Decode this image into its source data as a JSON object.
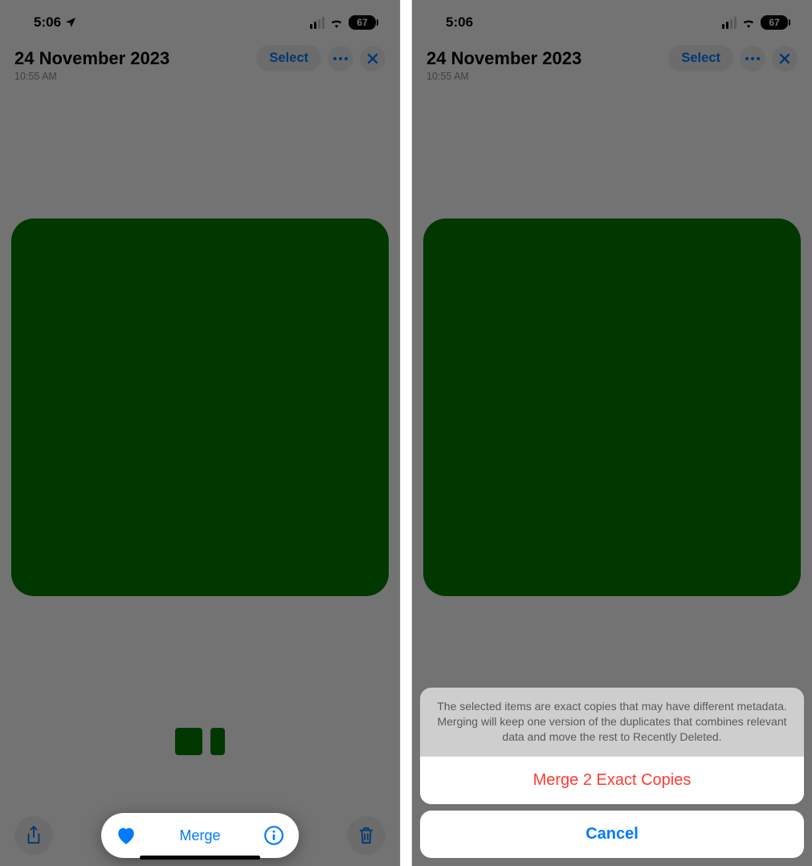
{
  "status": {
    "time": "5:06",
    "battery": "67"
  },
  "header": {
    "date": "24 November 2023",
    "time": "10:55 AM",
    "select_label": "Select"
  },
  "toolbar": {
    "merge_label": "Merge"
  },
  "actionsheet": {
    "message": "The selected items are exact copies that may have different metadata. Merging will keep one version of the duplicates that combines relevant data and move the rest to Recently Deleted.",
    "merge_action": "Merge 2 Exact Copies",
    "cancel": "Cancel"
  },
  "colors": {
    "accent": "#007aff",
    "destructive": "#ff3b30",
    "photo": "#007d00"
  }
}
